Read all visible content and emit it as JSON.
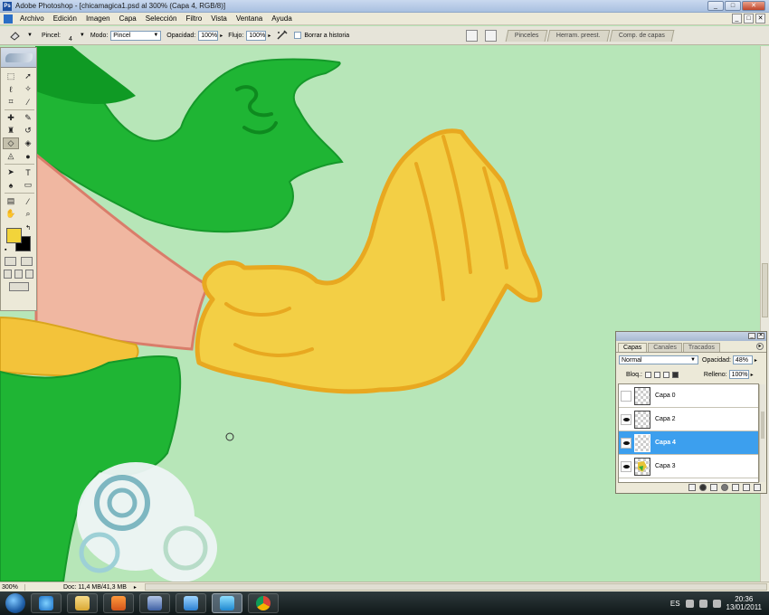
{
  "window": {
    "title": "Adobe Photoshop - [chicamagica1.psd al 300% (Capa 4, RGB/8)]",
    "controls": [
      "_",
      "□",
      "✕"
    ]
  },
  "menu": {
    "items": [
      "Archivo",
      "Edición",
      "Imagen",
      "Capa",
      "Selección",
      "Filtro",
      "Vista",
      "Ventana",
      "Ayuda"
    ]
  },
  "options": {
    "brush_label": "Pincel:",
    "brush_size": "4",
    "mode_label": "Modo:",
    "mode_value": "Pincel",
    "opacity_label": "Opacidad:",
    "opacity_value": "100%",
    "flow_label": "Flujo:",
    "flow_value": "100%",
    "erase_history_label": "Borrar a historia",
    "well_tabs": [
      "Pinceles",
      "Herram. preest.",
      "Comp. de capas"
    ]
  },
  "toolbox": {
    "tools": [
      {
        "left": "marquee-icon",
        "right": "move-icon"
      },
      {
        "left": "lasso-icon",
        "right": "magic-wand-icon"
      },
      {
        "left": "crop-icon",
        "right": "slice-icon"
      },
      {
        "left": "healing-icon",
        "right": "brush-icon"
      },
      {
        "left": "stamp-icon",
        "right": "history-brush-icon"
      },
      {
        "left": "eraser-icon",
        "right": "bucket-icon"
      },
      {
        "left": "blur-icon",
        "right": "dodge-icon"
      },
      {
        "left": "path-select-icon",
        "right": "type-icon"
      },
      {
        "left": "pen-icon",
        "right": "shape-icon"
      },
      {
        "left": "notes-icon",
        "right": "eyedropper-icon"
      },
      {
        "left": "hand-icon",
        "right": "zoom-icon"
      }
    ],
    "foreground_color": "#f2d43a",
    "background_color": "#000000"
  },
  "layers_panel": {
    "tabs": [
      "Capas",
      "Canales",
      "Tracados"
    ],
    "blend_mode": "Normal",
    "opacity_label": "Opacidad:",
    "opacity_value": "48%",
    "lock_label": "Bloq.:",
    "fill_label": "Relleno:",
    "fill_value": "100%",
    "layers": [
      {
        "name": "Capa 0",
        "visible": false,
        "active": false
      },
      {
        "name": "Capa 2",
        "visible": true,
        "active": false
      },
      {
        "name": "Capa 4",
        "visible": true,
        "active": true
      },
      {
        "name": "Capa 3",
        "visible": true,
        "active": false
      }
    ]
  },
  "status": {
    "zoom": "300%",
    "doc_info": "Doc: 11,4 MB/41,3 MB"
  },
  "taskbar": {
    "language": "ES",
    "time": "20:36",
    "date": "13/01/2011"
  },
  "colors": {
    "canvas_bg": "#b7e6b8",
    "active_layer": "#3c9fee",
    "glove_yellow": "#f3cf45",
    "glove_outline": "#e8a820",
    "sleeve_green": "#1fb534",
    "skin": "#f0b7a1"
  }
}
